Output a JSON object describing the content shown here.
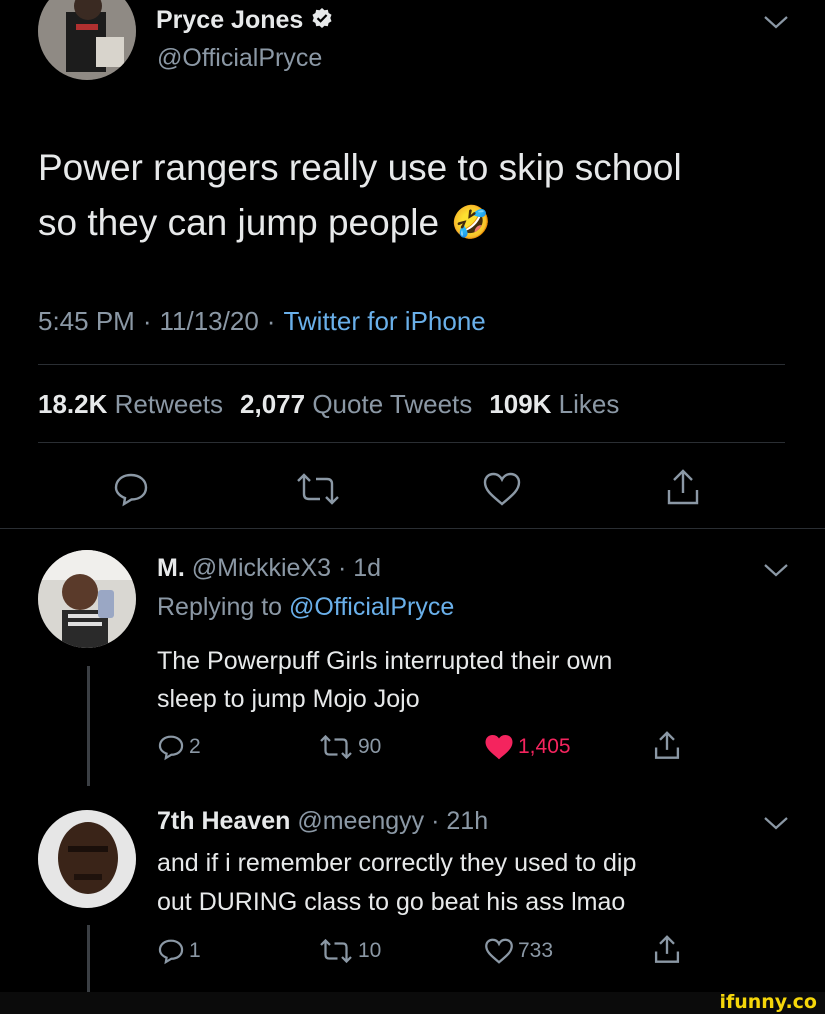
{
  "tweet": {
    "author_name": "Pryce Jones",
    "author_handle": "@OfficialPryce",
    "text_line1": "Power rangers really use to skip school",
    "text_line2": "so they can jump people",
    "emoji": "🤣",
    "meta_time": "5:45 PM",
    "meta_date": "11/13/20",
    "meta_source": "Twitter for iPhone",
    "sep": "·",
    "stats": {
      "retweets_count": "18.2K",
      "retweets_label": "Retweets",
      "quotes_count": "2,077",
      "quotes_label": "Quote Tweets",
      "likes_count": "109K",
      "likes_label": "Likes"
    }
  },
  "replies": [
    {
      "name": "M.",
      "handle": "@MickkieX3",
      "time": "1d",
      "replying_prefix": "Replying to",
      "replying_handle": "@OfficialPryce",
      "text_line1": "The Powerpuff Girls interrupted their own",
      "text_line2": "sleep to jump Mojo Jojo",
      "reply_count": "2",
      "retweet_count": "90",
      "like_count": "1,405",
      "liked": true
    },
    {
      "name": "7th Heaven",
      "handle": "@meengyy",
      "time": "21h",
      "text_line1": "and if i remember correctly they used to dip",
      "text_line2": "out DURING class to go beat his ass lmao",
      "reply_count": "1",
      "retweet_count": "10",
      "like_count": "733",
      "liked": false
    }
  ],
  "watermark": "ifunny.co",
  "colors": {
    "accent": "#6ab0ea",
    "like": "#f4245e",
    "muted": "#8b98a5"
  }
}
